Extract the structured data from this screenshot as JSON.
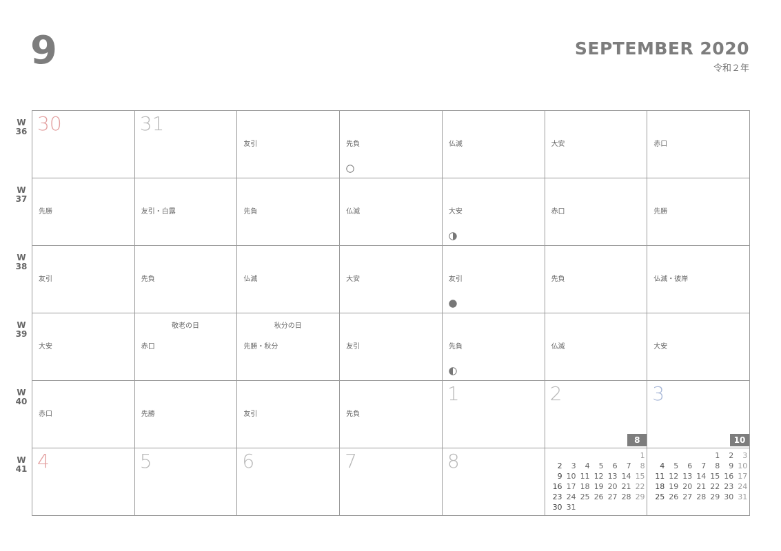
{
  "header": {
    "month_number": "9",
    "month_title": "SEPTEMBER 2020",
    "era": "令和２年"
  },
  "weeks": [
    {
      "label": "W",
      "num": "36",
      "days": [
        {
          "date": "30",
          "type": "sunday",
          "rokuyo": "",
          "holiday": "",
          "moon": ""
        },
        {
          "date": "31",
          "type": "weekday",
          "rokuyo": "",
          "holiday": "",
          "moon": ""
        },
        {
          "date": "",
          "type": "weekday",
          "rokuyo": "友引",
          "holiday": "",
          "moon": ""
        },
        {
          "date": "",
          "type": "weekday",
          "rokuyo": "先負",
          "holiday": "",
          "moon": "full-moon-icon"
        },
        {
          "date": "",
          "type": "weekday",
          "rokuyo": "仏滅",
          "holiday": "",
          "moon": ""
        },
        {
          "date": "",
          "type": "weekday",
          "rokuyo": "大安",
          "holiday": "",
          "moon": ""
        },
        {
          "date": "",
          "type": "saturday",
          "rokuyo": "赤口",
          "holiday": "",
          "moon": ""
        }
      ]
    },
    {
      "label": "W",
      "num": "37",
      "days": [
        {
          "date": "",
          "type": "sunday",
          "rokuyo": "先勝",
          "holiday": "",
          "moon": ""
        },
        {
          "date": "",
          "type": "weekday",
          "rokuyo": "友引・白露",
          "holiday": "",
          "moon": ""
        },
        {
          "date": "",
          "type": "weekday",
          "rokuyo": "先負",
          "holiday": "",
          "moon": ""
        },
        {
          "date": "",
          "type": "weekday",
          "rokuyo": "仏滅",
          "holiday": "",
          "moon": ""
        },
        {
          "date": "",
          "type": "weekday",
          "rokuyo": "大安",
          "holiday": "",
          "moon": "last-quarter-moon-icon"
        },
        {
          "date": "",
          "type": "weekday",
          "rokuyo": "赤口",
          "holiday": "",
          "moon": ""
        },
        {
          "date": "",
          "type": "saturday",
          "rokuyo": "先勝",
          "holiday": "",
          "moon": ""
        }
      ]
    },
    {
      "label": "W",
      "num": "38",
      "days": [
        {
          "date": "",
          "type": "sunday",
          "rokuyo": "友引",
          "holiday": "",
          "moon": ""
        },
        {
          "date": "",
          "type": "weekday",
          "rokuyo": "先負",
          "holiday": "",
          "moon": ""
        },
        {
          "date": "",
          "type": "weekday",
          "rokuyo": "仏滅",
          "holiday": "",
          "moon": ""
        },
        {
          "date": "",
          "type": "weekday",
          "rokuyo": "大安",
          "holiday": "",
          "moon": ""
        },
        {
          "date": "",
          "type": "weekday",
          "rokuyo": "友引",
          "holiday": "",
          "moon": "new-moon-icon"
        },
        {
          "date": "",
          "type": "weekday",
          "rokuyo": "先負",
          "holiday": "",
          "moon": ""
        },
        {
          "date": "",
          "type": "saturday",
          "rokuyo": "仏滅・彼岸",
          "holiday": "",
          "moon": ""
        }
      ]
    },
    {
      "label": "W",
      "num": "39",
      "days": [
        {
          "date": "",
          "type": "sunday",
          "rokuyo": "大安",
          "holiday": "",
          "moon": ""
        },
        {
          "date": "",
          "type": "weekday",
          "rokuyo": "赤口",
          "holiday": "敬老の日",
          "moon": ""
        },
        {
          "date": "",
          "type": "weekday",
          "rokuyo": "先勝・秋分",
          "holiday": "秋分の日",
          "moon": ""
        },
        {
          "date": "",
          "type": "weekday",
          "rokuyo": "友引",
          "holiday": "",
          "moon": ""
        },
        {
          "date": "",
          "type": "weekday",
          "rokuyo": "先負",
          "holiday": "",
          "moon": "first-quarter-moon-icon"
        },
        {
          "date": "",
          "type": "weekday",
          "rokuyo": "仏滅",
          "holiday": "",
          "moon": ""
        },
        {
          "date": "",
          "type": "saturday",
          "rokuyo": "大安",
          "holiday": "",
          "moon": ""
        }
      ]
    },
    {
      "label": "W",
      "num": "40",
      "days": [
        {
          "date": "",
          "type": "sunday",
          "rokuyo": "赤口",
          "holiday": "",
          "moon": ""
        },
        {
          "date": "",
          "type": "weekday",
          "rokuyo": "先勝",
          "holiday": "",
          "moon": ""
        },
        {
          "date": "",
          "type": "weekday",
          "rokuyo": "友引",
          "holiday": "",
          "moon": ""
        },
        {
          "date": "",
          "type": "weekday",
          "rokuyo": "先負",
          "holiday": "",
          "moon": ""
        },
        {
          "date": "1",
          "type": "weekday",
          "rokuyo": "",
          "holiday": "",
          "moon": ""
        },
        {
          "date": "2",
          "type": "weekday",
          "rokuyo": "",
          "holiday": "",
          "moon": "",
          "badge": "8"
        },
        {
          "date": "3",
          "type": "saturday",
          "rokuyo": "",
          "holiday": "",
          "moon": "",
          "badge": "10"
        }
      ]
    },
    {
      "label": "W",
      "num": "41",
      "days": [
        {
          "date": "4",
          "type": "sunday",
          "rokuyo": "",
          "holiday": "",
          "moon": ""
        },
        {
          "date": "5",
          "type": "weekday",
          "rokuyo": "",
          "holiday": "",
          "moon": ""
        },
        {
          "date": "6",
          "type": "weekday",
          "rokuyo": "",
          "holiday": "",
          "moon": ""
        },
        {
          "date": "7",
          "type": "weekday",
          "rokuyo": "",
          "holiday": "",
          "moon": ""
        },
        {
          "date": "8",
          "type": "weekday",
          "rokuyo": "",
          "holiday": "",
          "moon": ""
        },
        {
          "date": "",
          "type": "weekday",
          "rokuyo": "",
          "holiday": "",
          "moon": "",
          "mini": "august"
        },
        {
          "date": "",
          "type": "saturday",
          "rokuyo": "",
          "holiday": "",
          "moon": "",
          "mini": "october"
        }
      ]
    }
  ],
  "mini_calendars": {
    "august": {
      "month": "8",
      "rows": [
        [
          "",
          "",
          "",
          "",
          "",
          "",
          "1"
        ],
        [
          "2",
          "3",
          "4",
          "5",
          "6",
          "7",
          "8"
        ],
        [
          "9",
          "10",
          "11",
          "12",
          "13",
          "14",
          "15"
        ],
        [
          "16",
          "17",
          "18",
          "19",
          "20",
          "21",
          "22"
        ],
        [
          "23",
          "24",
          "25",
          "26",
          "27",
          "28",
          "29"
        ],
        [
          "30",
          "31",
          "",
          "",
          "",
          "",
          ""
        ]
      ]
    },
    "october": {
      "month": "10",
      "rows": [
        [
          "",
          "",
          "",
          "",
          "1",
          "2",
          "3"
        ],
        [
          "4",
          "5",
          "6",
          "7",
          "8",
          "9",
          "10"
        ],
        [
          "11",
          "12",
          "13",
          "14",
          "15",
          "16",
          "17"
        ],
        [
          "18",
          "19",
          "20",
          "21",
          "22",
          "23",
          "24"
        ],
        [
          "25",
          "26",
          "27",
          "28",
          "29",
          "30",
          "31"
        ]
      ]
    }
  },
  "colors": {
    "grid_line": "#9a9a9a",
    "sunday": "#e3a0a0",
    "saturday": "#a7b7d7",
    "weekday": "#b8b8b8",
    "badge": "#7d7d7d"
  }
}
